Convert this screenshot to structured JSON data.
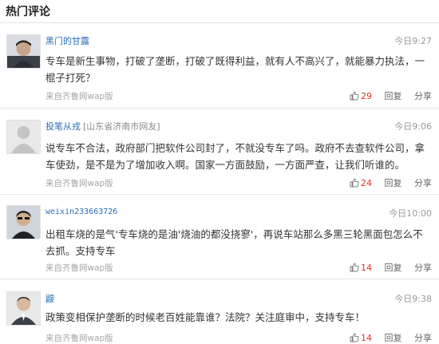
{
  "section_title": "热门评论",
  "actions": {
    "reply": "回复",
    "share": "分享"
  },
  "colors": {
    "username": "#2a6fb7",
    "like": "#e0312d",
    "muted": "#9a9a9a"
  },
  "comments": [
    {
      "username": "黑门的甘露",
      "location": "",
      "time": "今日9:27",
      "text": "专车是新生事物，打破了垄断，打破了既得利益，就有人不高兴了，就能暴力执法，一棍子打死？",
      "source": "来自齐鲁网wap版",
      "likes": "29",
      "avatar_icon": "user-photo-icon"
    },
    {
      "username": "投笔从戎",
      "location": "[山东省济南市网友]",
      "time": "今日9:06",
      "text": "说专车不合法，政府部门把软件公司封了，不就没专车了吗。政府不去查软件公司，拿车使劲，是不是为了增加收入啊。国家一方面鼓励，一方面严查，让我们听谁的。",
      "source": "来自齐鲁网wap版",
      "likes": "24",
      "avatar_icon": "default-avatar-icon"
    },
    {
      "username": "weixin233663726",
      "location": "",
      "time": "今日10:00",
      "text": "出租车烧的是气'专车烧的是油'烧油的都没挠寥'，再说车站那么多黑三轮黑面包怎么不去抓。支持专车",
      "source": "来自齐鲁网wap版",
      "likes": "14",
      "avatar_icon": "user-photo-icon"
    },
    {
      "username": "鼹",
      "location": "",
      "time": "今日9:38",
      "text": "政策变相保护垄断的时候老百姓能靠谁？法院？关注庭审中，支持专车！",
      "source": "来自齐鲁网wap版",
      "likes": "14",
      "avatar_icon": "user-photo-icon"
    }
  ]
}
